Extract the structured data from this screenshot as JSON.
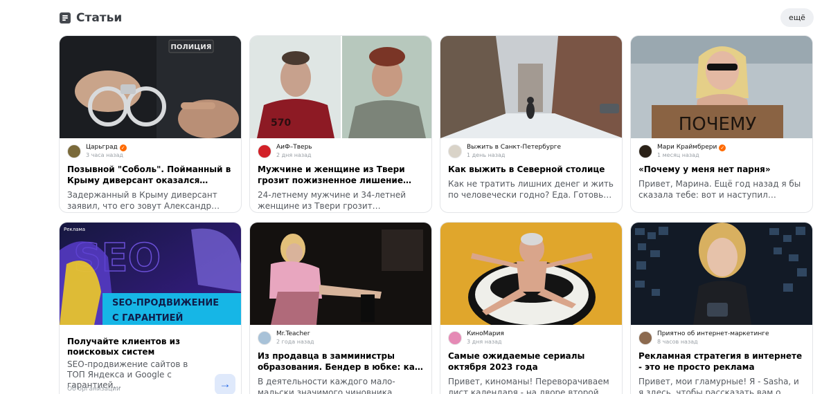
{
  "section": {
    "title": "Статьи",
    "icon": "article-icon",
    "more_label": "ещё"
  },
  "row1": [
    {
      "source": "Царьград",
      "verified": true,
      "time": "3 часа назад",
      "title": "Позывной \"Соболь\". Пойманный в Крыму диверсант оказался \"народным...",
      "excerpt": "Задержанный в Крыму диверсант заявил, что его зовут Александр Лобас. По данны...",
      "image_text": "ПОЛИЦИЯ"
    },
    {
      "source": "АиФ–Тверь",
      "verified": false,
      "time": "2 дня назад",
      "title": "Мужчине и женщине из Твери грозит пожизненное лишение свободы",
      "excerpt": "24-летнему мужчине и 34-летней женщине из Твери грозит пожизненное лишение...",
      "image_text": "570"
    },
    {
      "source": "Выжить в Санкт-Петербурге",
      "verified": false,
      "time": "1 день назад",
      "title": "Как выжить в Северной столице",
      "excerpt": "Как не тратить лишних денег и жить по человечески годно? Еда. Готовьте дома На первый взгляд бизнес-ланчи в кафе не..."
    },
    {
      "source": "Мари Краймбрери",
      "verified": true,
      "time": "1 месяц назад",
      "title": "«Почему у меня нет парня»",
      "excerpt": "Привет, Марина. Ещё год назад я бы сказала тебе: вот и наступил очередной твой день рождения. Но сегодня это звуч...",
      "image_text": "ПОЧЕМУ"
    }
  ],
  "ad": {
    "badge": "Реклама",
    "image_line1": "SEO-ПРОДВИЖЕНИЕ",
    "image_line2": "С ГАРАНТИЕЙ",
    "image_bg_text": "SEO",
    "title": "Получайте клиентов из поисковых систем",
    "text": "SEO-продвижение сайтов в ТОП Яндекса и Google с гарантией...",
    "footer": "Об организации",
    "arrow": "→"
  },
  "row2": [
    {
      "source": "Mr.Teacher",
      "verified": false,
      "time": "2 года назад",
      "title": "Из продавца в замминистры образования. Бендер в юбке: как взош...",
      "excerpt": "В деятельности каждого мало-мальски значимого чиновника обязательно имеет..."
    },
    {
      "source": "КиноМария",
      "verified": false,
      "time": "3 дня назад",
      "title": "Самые ожидаемые сериалы октября 2023 года",
      "excerpt": "Привет, киноманы! Переворачиваем лист календаря - на дворе второй месяц осени..."
    },
    {
      "source": "Приятно об интернет-маркетинге",
      "verified": false,
      "time": "8 часов назад",
      "title": "Рекламная стратегия в интернете - это не просто реклама",
      "excerpt": "Привет, мои гламурные! Я - Sasha, и я здесь, чтобы рассказать вам о важности..."
    }
  ],
  "colors": {
    "accent": "#ff6a00",
    "ad_cyan": "#16b6e6",
    "ad_purple": "#3a1d8c",
    "arrow_blue": "#2467e6"
  }
}
